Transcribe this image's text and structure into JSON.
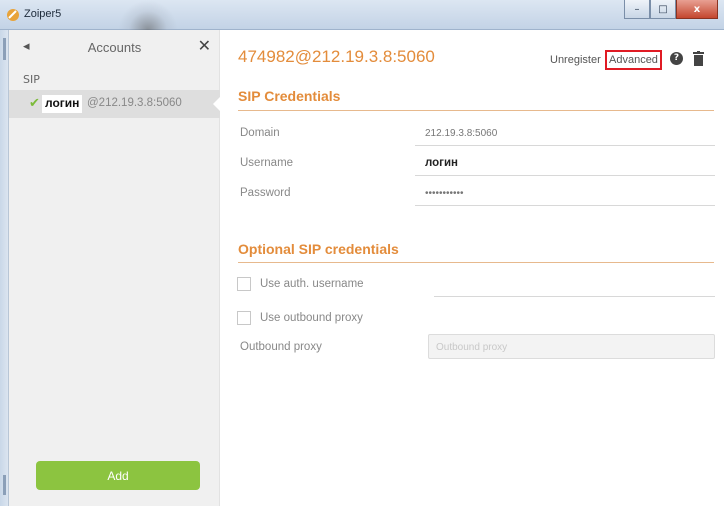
{
  "window": {
    "title": "Zoiper5",
    "minimize_glyph": "–",
    "maximize_glyph": "□",
    "close_glyph": "x"
  },
  "sidebar": {
    "back_glyph": "◂",
    "title": "Accounts",
    "close_glyph": "✕",
    "section": "SIP",
    "account": {
      "check_glyph": "✔",
      "user": "логин",
      "host": "@212.19.3.8:5060"
    },
    "add_label": "Add"
  },
  "header": {
    "account_title": "474982@212.19.3.8:5060",
    "unregister": "Unregister",
    "advanced": "Advanced",
    "help_glyph": "?"
  },
  "sip_credentials": {
    "title": "SIP Credentials",
    "fields": [
      {
        "label": "Domain",
        "value": "212.19.3.8:5060"
      },
      {
        "label": "Username",
        "value": "логин"
      },
      {
        "label": "Password",
        "value": "•••••••••••"
      }
    ]
  },
  "optional": {
    "title": "Optional SIP credentials",
    "use_auth": "Use auth. username",
    "use_proxy": "Use outbound proxy",
    "proxy_label": "Outbound proxy",
    "proxy_placeholder": "Outbound proxy"
  },
  "colors": {
    "accent": "#e38c3b",
    "add_button": "#8cc440",
    "highlight_box": "#e01b24",
    "check": "#7cbb3a"
  }
}
